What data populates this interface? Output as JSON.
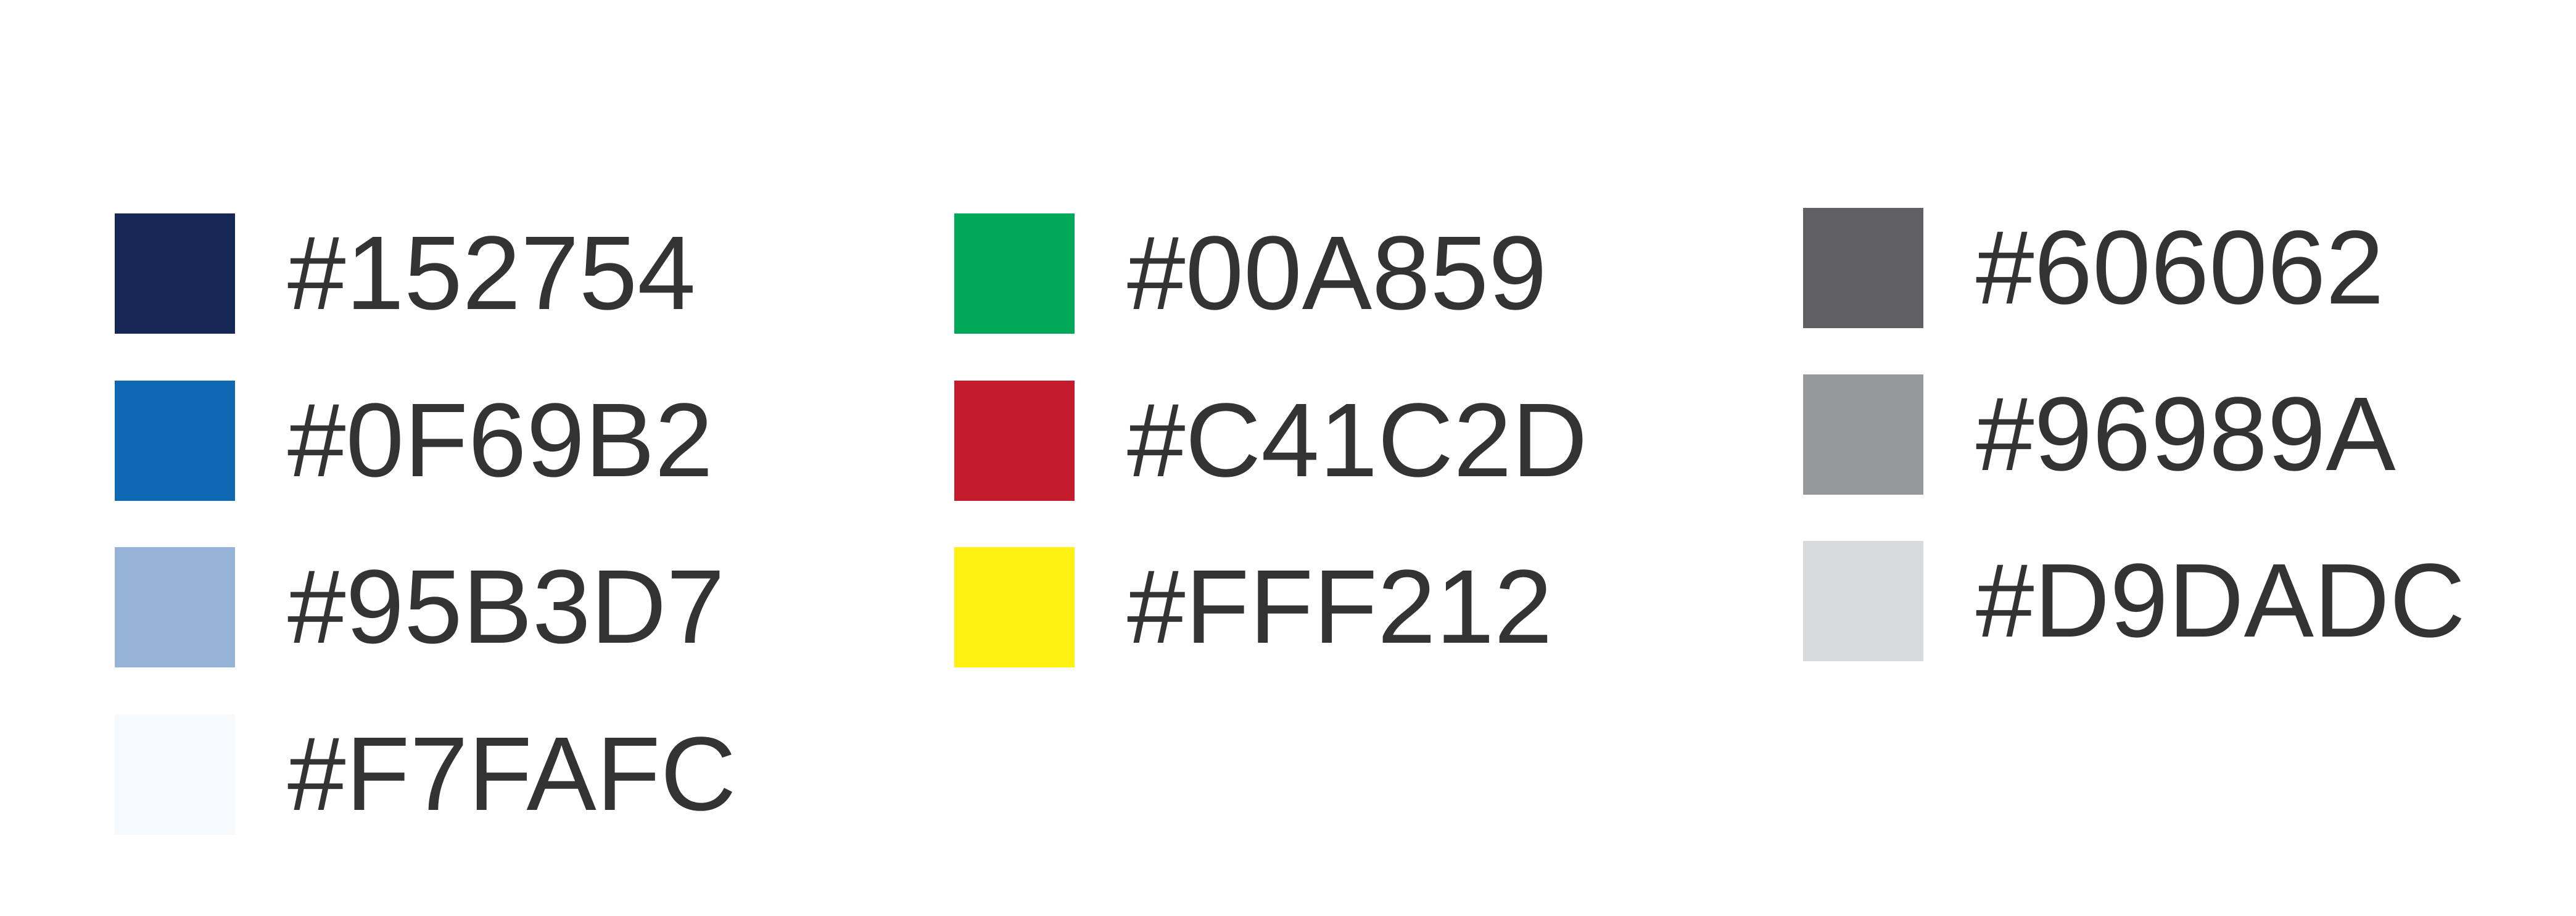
{
  "palette": {
    "columns": [
      {
        "swatches": [
          {
            "label": "#152754",
            "color": "#152754"
          },
          {
            "label": "#0F69B2",
            "color": "#0F69B2"
          },
          {
            "label": "#95B3D7",
            "color": "#95B3D7"
          },
          {
            "label": "#F7FAFC",
            "color": "#F7FAFC"
          }
        ]
      },
      {
        "swatches": [
          {
            "label": "#00A859",
            "color": "#00A859"
          },
          {
            "label": "#C41C2D",
            "color": "#C41C2D"
          },
          {
            "label": "#FFF212",
            "color": "#FFF212"
          }
        ]
      },
      {
        "swatches": [
          {
            "label": "#606062",
            "color": "#606062"
          },
          {
            "label": "#96989A",
            "color": "#96989A"
          },
          {
            "label": "#D9DADC",
            "color": "#D9DADC"
          }
        ]
      }
    ]
  }
}
